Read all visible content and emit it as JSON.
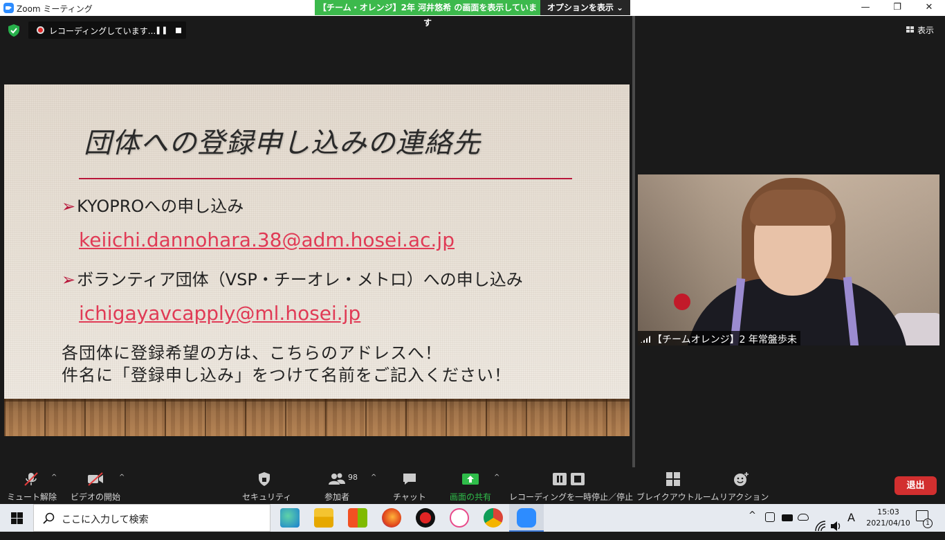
{
  "window": {
    "title": "Zoom ミーティング",
    "share_banner": "【チーム・オレンジ】2年 河井悠希 の画面を表示しています",
    "options_label": "オプションを表示 ⌄",
    "minimize": "—",
    "maximize": "❐",
    "close": "✕"
  },
  "recording": {
    "status": "レコーディングしています...",
    "pause_glyph": "❚❚"
  },
  "view_button": {
    "label": "表示"
  },
  "slide": {
    "title": "団体への登録申し込みの連絡先",
    "bullet1": "KYOPROへの申し込み",
    "email1": "keiichi.dannohara.38@adm.hosei.ac.jp",
    "bullet2": "ボランティア団体（VSP・チーオレ・メトロ）への申し込み",
    "email2": "ichigayavcapply@ml.hosei.jp",
    "note1": "各団体に登録希望の方は、こちらのアドレスへ！",
    "note2": "件名に「登録申し込み」をつけて名前をご記入ください！",
    "bullet_glyph": "➢",
    "accent_color": "#b8163a",
    "link_color": "#e03a55"
  },
  "participant": {
    "name": "【チームオレンジ】2 年常盤歩未"
  },
  "toolbar": {
    "mute": "ミュート解除",
    "video": "ビデオの開始",
    "security": "セキュリティ",
    "participants": "参加者",
    "participant_count": "98",
    "chat": "チャット",
    "share": "画面の共有",
    "record_control": "レコーディングを一時停止／停止",
    "breakout": "ブレイクアウトルーム",
    "reactions": "リアクション",
    "leave": "退出",
    "caret": "^",
    "share_color": "#2fbd4a",
    "leave_color": "#d22f2f"
  },
  "taskbar": {
    "search_placeholder": "ここに入力して検索",
    "ime": "A",
    "time": "15:03",
    "date": "2021/04/10",
    "notification_count": "1",
    "tray_up": "^"
  }
}
